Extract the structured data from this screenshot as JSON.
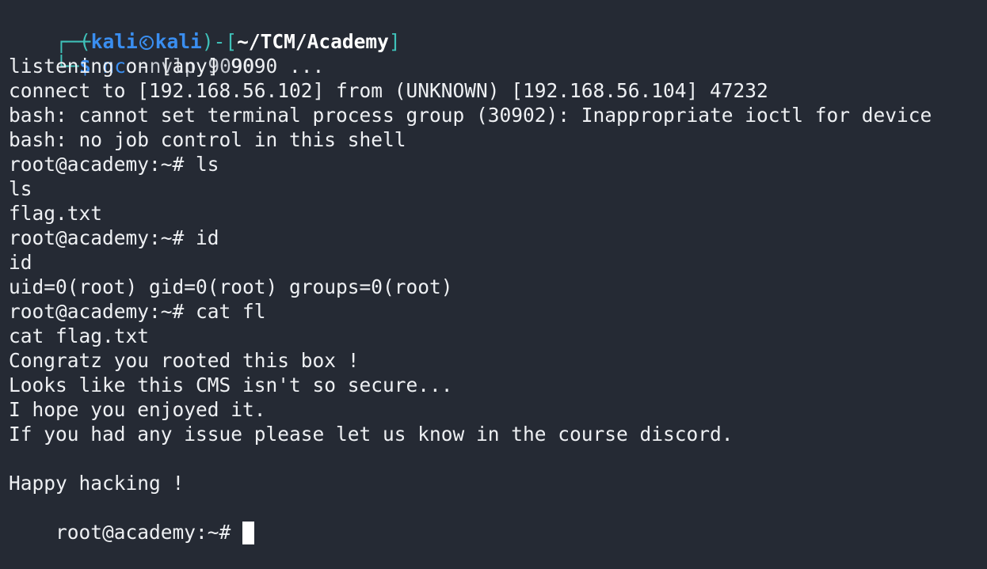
{
  "prompt": {
    "open_paren": "(",
    "user": "kali",
    "host": "kali",
    "close_paren": ")",
    "dash": "-",
    "open_bracket": "[",
    "path": "~/TCM/Academy",
    "close_bracket": "]",
    "dollar": "$"
  },
  "command": {
    "name": "nc",
    "args": " -nvlp 9090"
  },
  "output": [
    "listening on [any] 9090 ...",
    "connect to [192.168.56.102] from (UNKNOWN) [192.168.56.104] 47232",
    "bash: cannot set terminal process group (30902): Inappropriate ioctl for device",
    "bash: no job control in this shell",
    "root@academy:~# ls",
    "ls",
    "flag.txt",
    "root@academy:~# id",
    "id",
    "uid=0(root) gid=0(root) groups=0(root)",
    "root@academy:~# cat fl",
    "cat flag.txt",
    "Congratz you rooted this box !",
    "Looks like this CMS isn't so secure...",
    "I hope you enjoyed it.",
    "If you had any issue please let us know in the course discord.",
    "",
    "Happy hacking !"
  ],
  "final_prompt": "root@academy:~# ",
  "colors": {
    "background": "#252a34",
    "text": "#eef0f3",
    "prompt_frame": "#3fc1b9",
    "prompt_accent": "#3a8ef0"
  },
  "icons": {
    "kali_logo": "kali-dragon-icon",
    "cursor": "block-cursor"
  }
}
